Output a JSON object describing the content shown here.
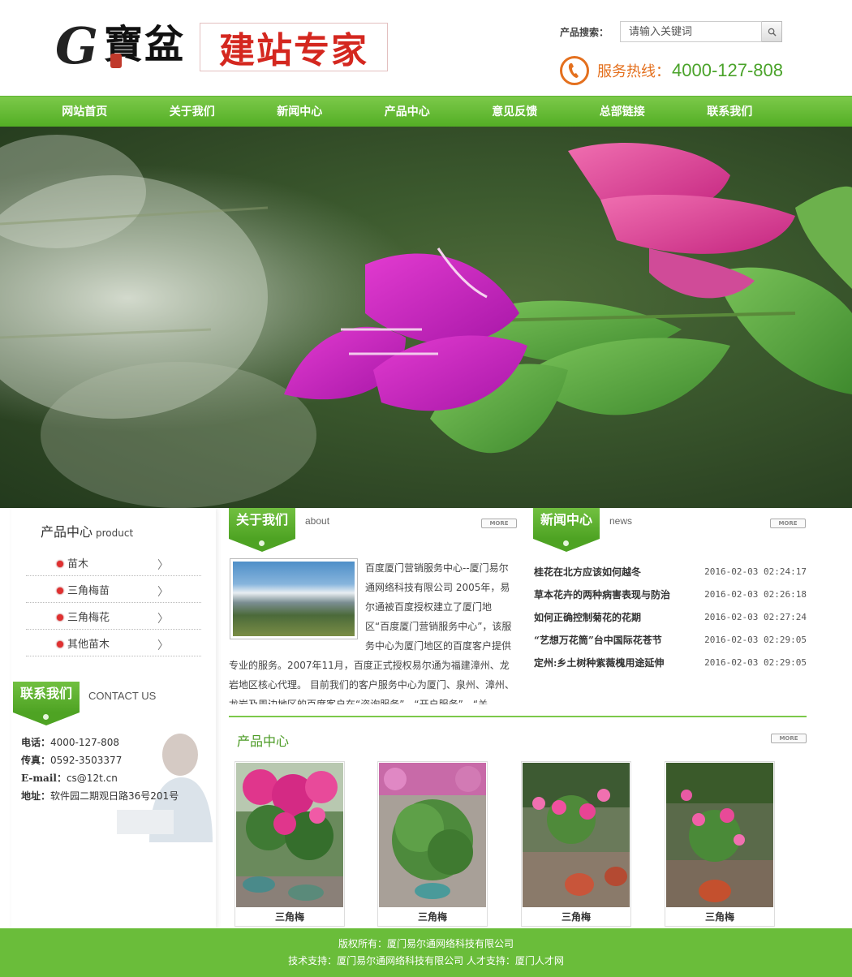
{
  "brand": {
    "logo_g": "G",
    "logo_bao": "寶盆",
    "slogan": "建站专家"
  },
  "search": {
    "label": "产品搜索：",
    "placeholder": "请输入关键词",
    "button_icon": "search-icon"
  },
  "hotline": {
    "label": "服务热线：",
    "number": "4000-127-808",
    "icon": "phone-icon"
  },
  "nav": {
    "items": [
      "网站首页",
      "关于我们",
      "新闻中心",
      "产品中心",
      "意见反馈",
      "总部链接",
      "联系我们"
    ]
  },
  "categories": {
    "title": "产品中心",
    "title_en": "product",
    "items": [
      "苗木",
      "三角梅苗",
      "三角梅花",
      "其他苗木"
    ]
  },
  "contact": {
    "title": "联系我们",
    "title_en": "CONTACT US",
    "phone_label": "电话：",
    "phone": "4000-127-808",
    "fax_label": "传真：",
    "fax": "0592-3503377",
    "email_label": "E-mail：",
    "email": "cs@12t.cn",
    "address_label": "地址：",
    "address": "软件园二期观日路36号201号"
  },
  "about": {
    "title": "关于我们",
    "title_en": "about",
    "more": "MORE",
    "text": "百度厦门营销服务中心--厦门易尔通网络科技有限公司 2005年，易尔通被百度授权建立了厦门地区“百度厦门营销服务中心”，该服务中心为厦门地区的百度客户提供专业的服务。2007年11月，百度正式授权易尔通为福建漳州、龙岩地区核心代理。 目前我们的客户服务中心为厦门、泉州、漳州、龙岩及周边地区的百度客户在“咨询服务”、“开户服务”、“关"
  },
  "news": {
    "title": "新闻中心",
    "title_en": "news",
    "more": "MORE",
    "items": [
      {
        "title": "桂花在北方应该如何越冬",
        "date": "2016-02-03 02:24:17"
      },
      {
        "title": "草本花卉的两种病害表现与防治",
        "date": "2016-02-03 02:26:18"
      },
      {
        "title": "如何正确控制菊花的花期",
        "date": "2016-02-03 02:27:24"
      },
      {
        "title": "“艺想万花筒”台中国际花苍节",
        "date": "2016-02-03 02:29:05"
      },
      {
        "title": "定州:乡土树种紫薇槐用途延伸",
        "date": "2016-02-03 02:29:05"
      }
    ]
  },
  "products": {
    "title": "产品中心",
    "more": "MORE",
    "items": [
      {
        "name": "三角梅"
      },
      {
        "name": "三角梅"
      },
      {
        "name": "三角梅"
      },
      {
        "name": "三角梅"
      }
    ]
  },
  "footer": {
    "line1": "版权所有：厦门易尔通网络科技有限公司",
    "line2": "技术支持：厦门易尔通网络科技有限公司  人才支持：厦门人才网"
  },
  "colors": {
    "brand_green": "#53ae25",
    "footer_green": "#6abd3a",
    "accent_orange": "#e4701e",
    "slogan_red": "#d4271f",
    "bullet_red": "#e03030"
  }
}
